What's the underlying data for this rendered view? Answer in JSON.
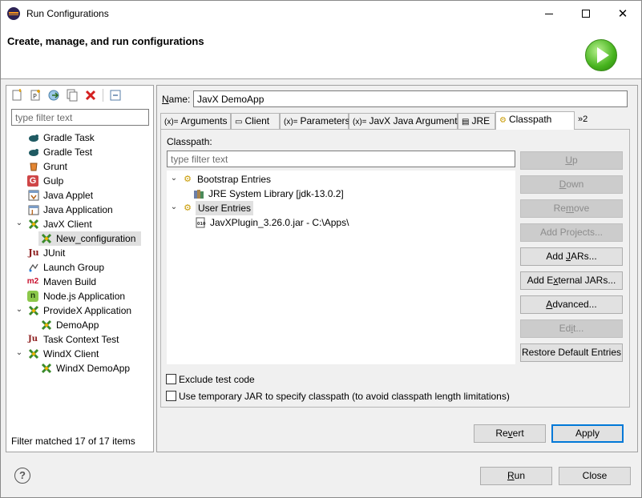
{
  "window": {
    "title": "Run Configurations",
    "header_title": "Create, manage, and run configurations"
  },
  "left": {
    "filter_placeholder": "type filter text",
    "toolbar_icons": [
      "new-configuration-icon",
      "new-prototype-icon",
      "export-icon",
      "duplicate-icon",
      "delete-icon",
      "collapse-all-icon"
    ],
    "items": [
      {
        "label": "Gradle Task",
        "icon": "gradle-icon"
      },
      {
        "label": "Gradle Test",
        "icon": "gradle-icon"
      },
      {
        "label": "Grunt",
        "icon": "grunt-icon"
      },
      {
        "label": "Gulp",
        "icon": "gulp-icon"
      },
      {
        "label": "Java Applet",
        "icon": "java-applet-icon"
      },
      {
        "label": "Java Application",
        "icon": "java-application-icon"
      },
      {
        "label": "JavX Client",
        "icon": "javx-icon"
      },
      {
        "label": "New_configuration",
        "icon": "javx-icon"
      },
      {
        "label": "JUnit",
        "icon": "junit-icon"
      },
      {
        "label": "Launch Group",
        "icon": "launch-group-icon"
      },
      {
        "label": "Maven Build",
        "icon": "maven-icon"
      },
      {
        "label": "Node.js Application",
        "icon": "nodejs-icon"
      },
      {
        "label": "ProvideX Application",
        "icon": "providex-icon"
      },
      {
        "label": "DemoApp",
        "icon": "providex-icon"
      },
      {
        "label": "Task Context Test",
        "icon": "task-context-icon"
      },
      {
        "label": "WindX Client",
        "icon": "windx-icon"
      },
      {
        "label": "WindX DemoApp",
        "icon": "windx-icon"
      }
    ],
    "filter_status": "Filter matched 17 of 17 items"
  },
  "right": {
    "name_label": "Name:",
    "name_value": "JavX DemoApp",
    "tabs": [
      "Arguments",
      "Client",
      "Parameters",
      "JavX Java Arguments",
      "JRE",
      "Classpath"
    ],
    "tab_overflow": "»2",
    "classpath_label": "Classpath:",
    "classpath_filter_placeholder": "type filter text",
    "tree": [
      {
        "label": "Bootstrap Entries"
      },
      {
        "label": "JRE System Library [jdk-13.0.2]"
      },
      {
        "label": "User Entries"
      },
      {
        "label": "JavXPlugin_3.26.0.jar - C:\\Apps\\"
      }
    ],
    "buttons": {
      "up": "Up",
      "down": "Down",
      "remove": "Remove",
      "add_projects": "Add Projects...",
      "add_jars": "Add JARs...",
      "add_external_jars": "Add External JARs...",
      "advanced": "Advanced...",
      "edit": "Edit...",
      "restore_default": "Restore Default Entries"
    },
    "checkboxes": {
      "exclude_test": "Exclude test code",
      "use_temp_jar": "Use temporary JAR to specify classpath (to avoid classpath length limitations)"
    },
    "revert": "Revert",
    "apply": "Apply"
  },
  "footer": {
    "run": "Run",
    "close": "Close"
  },
  "colors": {
    "accent": "#0078d7",
    "run_logo": "#46b31d"
  }
}
